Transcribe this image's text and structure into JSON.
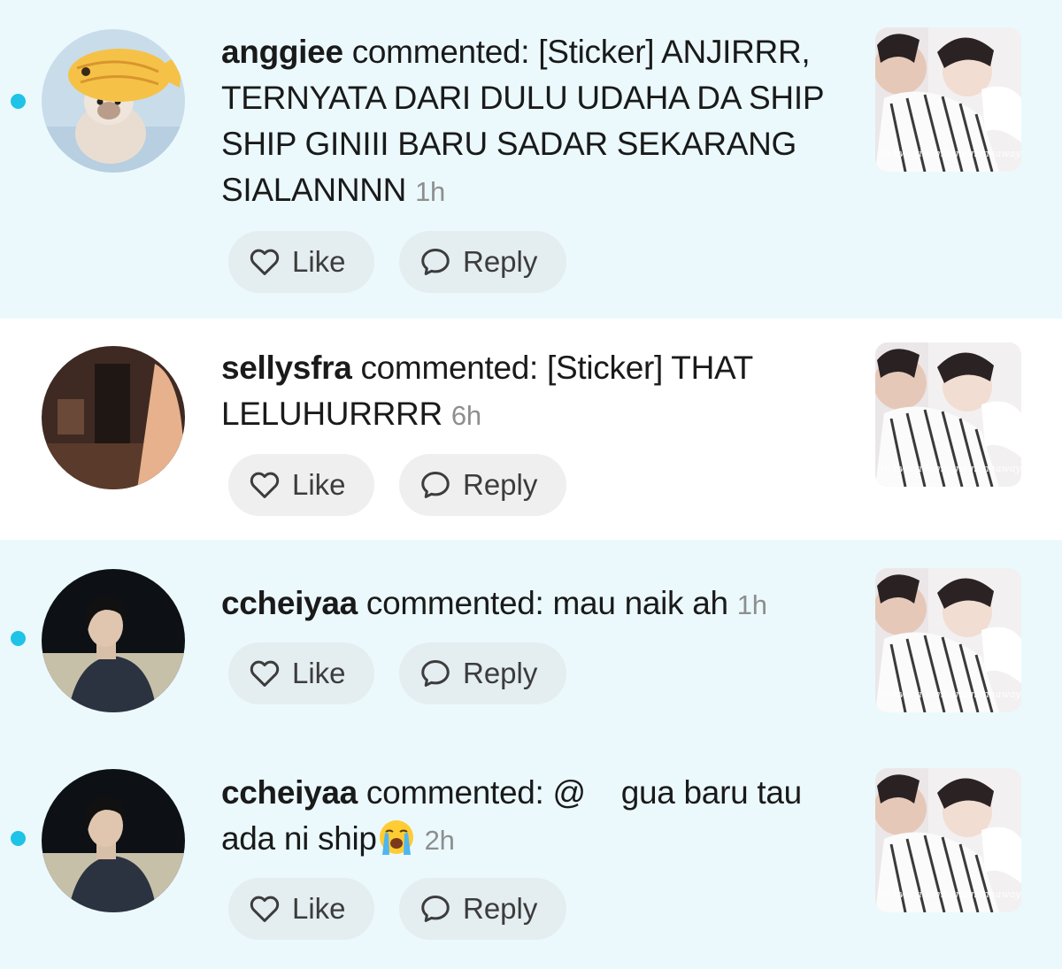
{
  "notifications": [
    {
      "unread": true,
      "avatar": "cat-with-fish-hat-avatar",
      "username": "anggiee",
      "action": " commented: ",
      "comment": "[Sticker] ANJIRRR, TERNYATA DARI DULU UDAHA DA SHIP SHIP GINIII BARU SADAR SEKARANG SIALANNNN",
      "time": "1h",
      "like_label": "Like",
      "reply_label": "Reply"
    },
    {
      "unread": false,
      "avatar": "dim-room-avatar",
      "username": "sellysfra",
      "action": " commented: ",
      "comment": "[Sticker] THAT LELUHURRRR",
      "time": "6h",
      "like_label": "Like",
      "reply_label": "Reply"
    },
    {
      "unread": true,
      "avatar": "person-night-avatar",
      "username": "ccheiyaa",
      "action": " commented: ",
      "comment": "mau naik ah",
      "time": "1h",
      "like_label": "Like",
      "reply_label": "Reply"
    },
    {
      "unread": true,
      "avatar": "person-night-avatar",
      "username": "ccheiyaa",
      "action": " commented: ",
      "comment": "@    gua baru tau ada ni ship",
      "emoji": "loudly-crying-face-emoji",
      "time": "2h",
      "like_label": "Like",
      "reply_label": "Reply"
    }
  ],
  "colors": {
    "unread_bg": "#ebf9fd",
    "unread_dot": "#1fc3e6",
    "button_bg": "#e4edf0",
    "time_text": "#8e8e8e"
  },
  "icons": [
    "heart-outline-icon",
    "speech-bubble-icon"
  ]
}
